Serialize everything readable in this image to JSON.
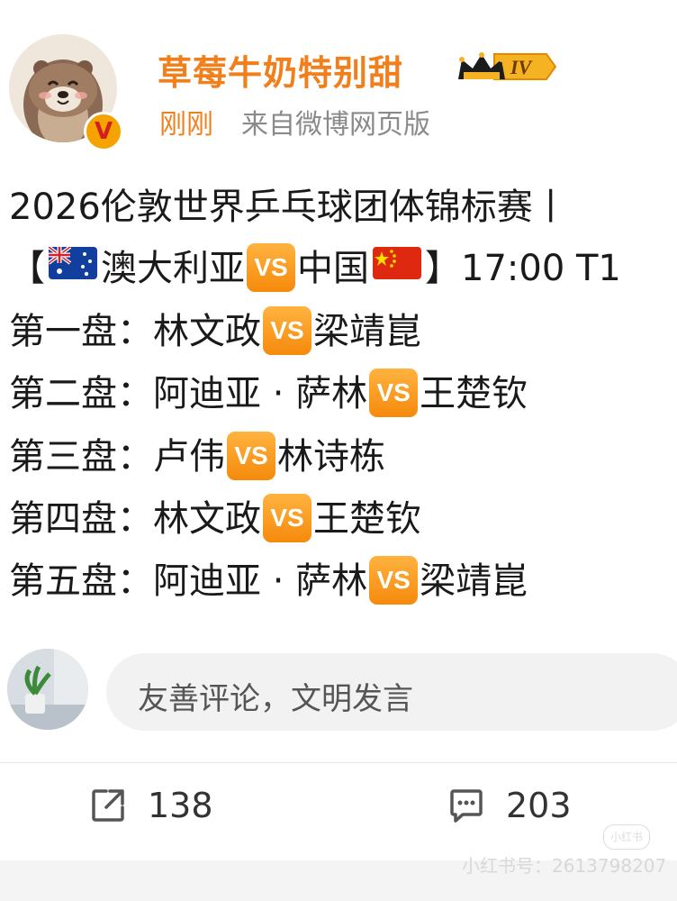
{
  "user": {
    "name": "草莓牛奶特别甜",
    "level": "IV",
    "verified_mark": "V",
    "time": "刚刚",
    "source": "来自微博网页版"
  },
  "post": {
    "title": "2026伦敦世界乒乓球团体锦标赛丨",
    "match_open": "【",
    "team_a": "澳大利亚",
    "team_b": "中国",
    "match_close": "】17:00 T1",
    "vs_label": "VS",
    "games": [
      {
        "label": "第一盘：",
        "player_a": "林文政",
        "player_b": "梁靖崑"
      },
      {
        "label": "第二盘：",
        "player_a": "阿迪亚 · 萨林",
        "player_b": "王楚钦"
      },
      {
        "label": "第三盘：",
        "player_a": "卢伟",
        "player_b": "林诗栋"
      },
      {
        "label": "第四盘：",
        "player_a": "林文政",
        "player_b": "王楚钦"
      },
      {
        "label": "第五盘：",
        "player_a": "阿迪亚 · 萨林",
        "player_b": "梁靖崑"
      }
    ]
  },
  "comment": {
    "placeholder": "友善评论，文明发言"
  },
  "actions": {
    "repost_count": "138",
    "comment_count": "203"
  },
  "watermark": {
    "text": "小红书号：2613798207",
    "logo": "小红书"
  },
  "colors": {
    "accent": "#f07f1c",
    "vs_orange": "#f58a0c",
    "meta_gray": "#8a8a8a"
  },
  "icons": [
    "otter-avatar-icon",
    "verified-v-icon",
    "crown-level-icon",
    "australia-flag-icon",
    "china-flag-icon",
    "repost-icon",
    "comment-icon"
  ]
}
